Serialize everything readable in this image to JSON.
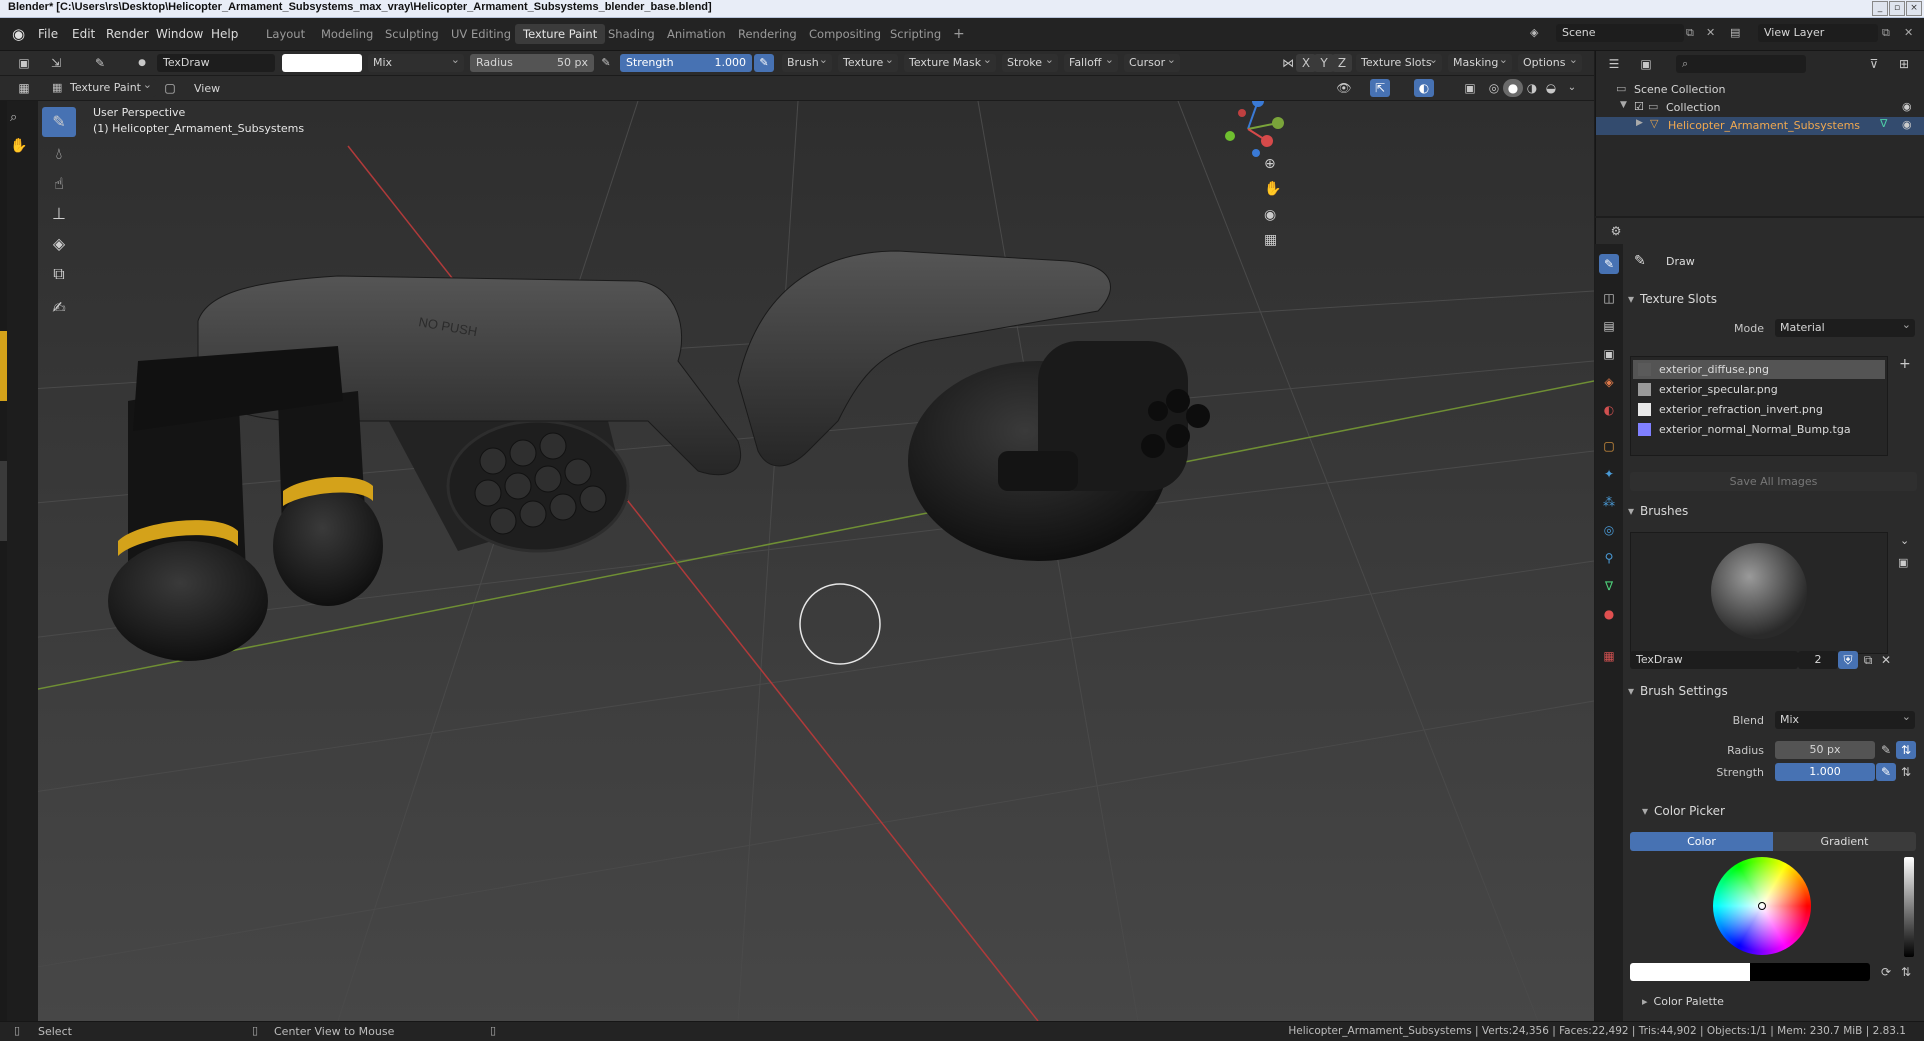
{
  "window": {
    "title": "Blender* [C:\\Users\\rs\\Desktop\\Helicopter_Armament_Subsystems_max_vray\\Helicopter_Armament_Subsystems_blender_base.blend]"
  },
  "menus": [
    "File",
    "Edit",
    "Render",
    "Window",
    "Help"
  ],
  "workspaces": [
    "Layout",
    "Modeling",
    "Sculpting",
    "UV Editing",
    "Texture Paint",
    "Shading",
    "Animation",
    "Rendering",
    "Compositing",
    "Scripting",
    "+"
  ],
  "active_workspace": "Texture Paint",
  "scene": {
    "label": "Scene",
    "view_layer": "View Layer"
  },
  "tool_settings": {
    "brush_name": "TexDraw",
    "blend_mode": "Mix",
    "radius_label": "Radius",
    "radius_value": "50 px",
    "strength_label": "Strength",
    "strength_value": "1.000",
    "menus": [
      "Brush",
      "Texture",
      "Texture Mask",
      "Stroke",
      "Falloff",
      "Cursor"
    ],
    "axes": [
      "X",
      "Y",
      "Z"
    ],
    "right_menus": [
      "Texture Slots",
      "Masking",
      "Options"
    ]
  },
  "viewport_header": {
    "mode": "Texture Paint",
    "view_menu": "View"
  },
  "viewport": {
    "perspective_text": "User Perspective",
    "object_text": "(1) Helicopter_Armament_Subsystems",
    "decal_text": "NO PUSH"
  },
  "outliner": {
    "root": "Scene Collection",
    "collection": "Collection",
    "object": "Helicopter_Armament_Subsystems"
  },
  "properties": {
    "tool_name": "Draw",
    "texture_slots_title": "Texture Slots",
    "mode_label": "Mode",
    "mode_value": "Material",
    "slots": [
      {
        "name": "exterior_diffuse.png",
        "color": "#5a5a5a"
      },
      {
        "name": "exterior_specular.png",
        "color": "#9a9a9a"
      },
      {
        "name": "exterior_refraction_invert.png",
        "color": "#e8e8e8"
      },
      {
        "name": "exterior_normal_Normal_Bump.tga",
        "color": "#8080ff"
      }
    ],
    "save_all": "Save All Images",
    "brushes_title": "Brushes",
    "brush_name": "TexDraw",
    "brush_users": "2",
    "brush_settings_title": "Brush Settings",
    "blend_label": "Blend",
    "blend_value": "Mix",
    "radius_label": "Radius",
    "radius_value": "50 px",
    "strength_label": "Strength",
    "strength_value": "1.000",
    "color_picker_title": "Color Picker",
    "color_tab": "Color",
    "gradient_tab": "Gradient",
    "color_palette_title": "Color Palette"
  },
  "statusbar": {
    "select": "Select",
    "center_view": "Center View to Mouse",
    "stats": "Helicopter_Armament_Subsystems | Verts:24,356 | Faces:22,492 | Tris:44,902 | Objects:1/1 | Mem: 230.7 MiB | 2.83.1"
  },
  "colors": {
    "accent": "#4772b3",
    "grid_x_axis": "#b03a3a",
    "grid_y_axis": "#6f8f34",
    "yellow_band": "#d4a21a"
  },
  "icons": [
    "blender-logo-icon",
    "brush-icon",
    "droplet-icon",
    "smudge-icon",
    "clone-icon",
    "fill-icon",
    "mask-icon",
    "annotate-icon",
    "zoom-icon",
    "hand-icon",
    "camera-icon",
    "grid-icon",
    "eye-icon",
    "filter-icon",
    "search-icon"
  ]
}
